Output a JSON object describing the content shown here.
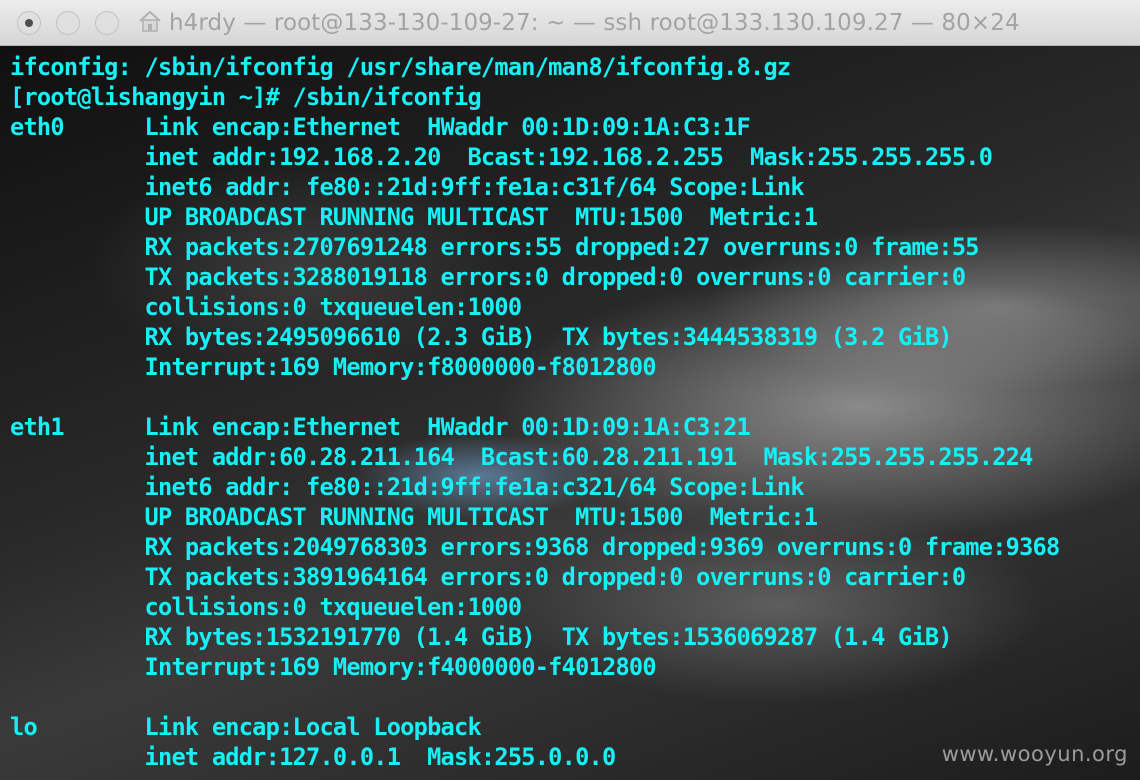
{
  "window": {
    "title": "h4rdy — root@133-130-109-27: ~ — ssh root@133.130.109.27 — 80×24",
    "home_icon": "home-icon"
  },
  "terminal": {
    "text_color": "#16f0f6",
    "lines": [
      "ifconfig: /sbin/ifconfig /usr/share/man/man8/ifconfig.8.gz",
      "[root@lishangyin ~]# /sbin/ifconfig",
      "eth0      Link encap:Ethernet  HWaddr 00:1D:09:1A:C3:1F",
      "          inet addr:192.168.2.20  Bcast:192.168.2.255  Mask:255.255.255.0",
      "          inet6 addr: fe80::21d:9ff:fe1a:c31f/64 Scope:Link",
      "          UP BROADCAST RUNNING MULTICAST  MTU:1500  Metric:1",
      "          RX packets:2707691248 errors:55 dropped:27 overruns:0 frame:55",
      "          TX packets:3288019118 errors:0 dropped:0 overruns:0 carrier:0",
      "          collisions:0 txqueuelen:1000",
      "          RX bytes:2495096610 (2.3 GiB)  TX bytes:3444538319 (3.2 GiB)",
      "          Interrupt:169 Memory:f8000000-f8012800",
      "",
      "eth1      Link encap:Ethernet  HWaddr 00:1D:09:1A:C3:21",
      "          inet addr:60.28.211.164  Bcast:60.28.211.191  Mask:255.255.255.224",
      "          inet6 addr: fe80::21d:9ff:fe1a:c321/64 Scope:Link",
      "          UP BROADCAST RUNNING MULTICAST  MTU:1500  Metric:1",
      "          RX packets:2049768303 errors:9368 dropped:9369 overruns:0 frame:9368",
      "          TX packets:3891964164 errors:0 dropped:0 overruns:0 carrier:0",
      "          collisions:0 txqueuelen:1000",
      "          RX bytes:1532191770 (1.4 GiB)  TX bytes:1536069287 (1.4 GiB)",
      "          Interrupt:169 Memory:f4000000-f4012800",
      "",
      "lo        Link encap:Local Loopback",
      "          inet addr:127.0.0.1  Mask:255.0.0.0"
    ]
  },
  "watermark": "www.wooyun.org"
}
